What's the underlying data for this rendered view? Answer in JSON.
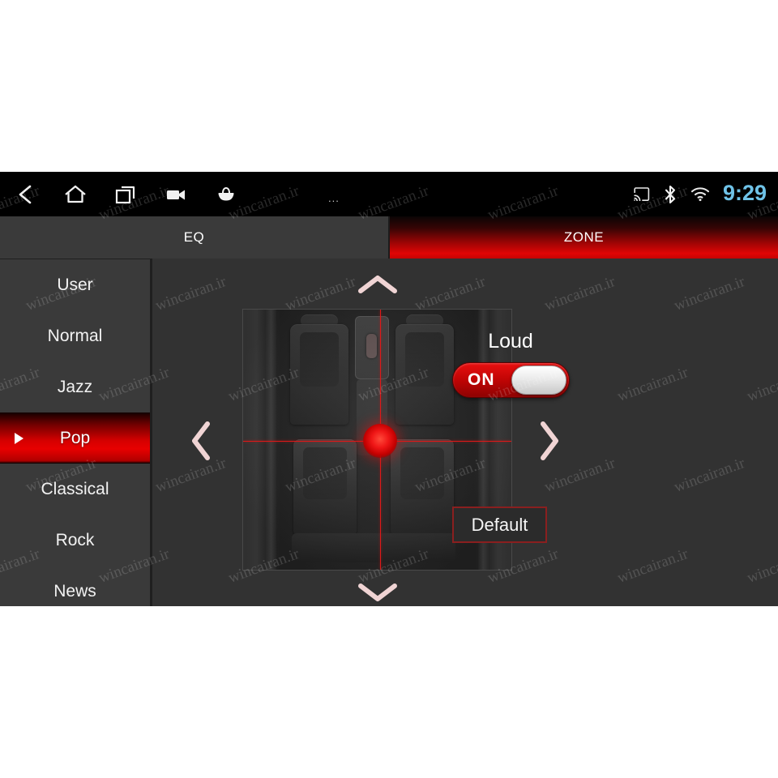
{
  "statusbar": {
    "nav_icons": [
      {
        "name": "back-icon",
        "label": "Back"
      },
      {
        "name": "home-icon",
        "label": "Home"
      },
      {
        "name": "recents-icon",
        "label": "Recents"
      },
      {
        "name": "video-camera-icon",
        "label": "Screen record"
      },
      {
        "name": "basket-icon",
        "label": "Apps"
      }
    ],
    "overflow": "...",
    "cast_icon": "cast-icon",
    "bluetooth_icon": "bluetooth-icon",
    "wifi_icon": "wifi-icon",
    "clock": "9:29",
    "clock_color": "#6fc3e8",
    "background_color": "#000000"
  },
  "tabs": [
    {
      "id": "eq",
      "label": "EQ",
      "active": false
    },
    {
      "id": "zone",
      "label": "ZONE",
      "active": true
    }
  ],
  "sidebar": {
    "selected": "Pop",
    "marker_icon": "play-triangle-icon",
    "items": [
      {
        "label": "User",
        "selected": false
      },
      {
        "label": "Normal",
        "selected": false
      },
      {
        "label": "Jazz",
        "selected": false
      },
      {
        "label": "Pop",
        "selected": true
      },
      {
        "label": "Classical",
        "selected": false
      },
      {
        "label": "Rock",
        "selected": false
      },
      {
        "label": "News",
        "selected": false
      }
    ]
  },
  "zone": {
    "image_name": "car-interior-top-view",
    "position_marker": "red-zone-dot",
    "arrows": {
      "up": "chevron-up-icon",
      "down": "chevron-down-icon",
      "left": "chevron-left-icon",
      "right": "chevron-right-icon"
    }
  },
  "controls": {
    "loud_label": "Loud",
    "loud_state": "ON",
    "default_label": "Default"
  },
  "theme": {
    "accent_red": "#e00505",
    "panel_bg": "#323232",
    "sidebar_bg": "#3a3a3a",
    "text": "#ffffff"
  },
  "watermark": {
    "text": "wincairan.ir"
  }
}
